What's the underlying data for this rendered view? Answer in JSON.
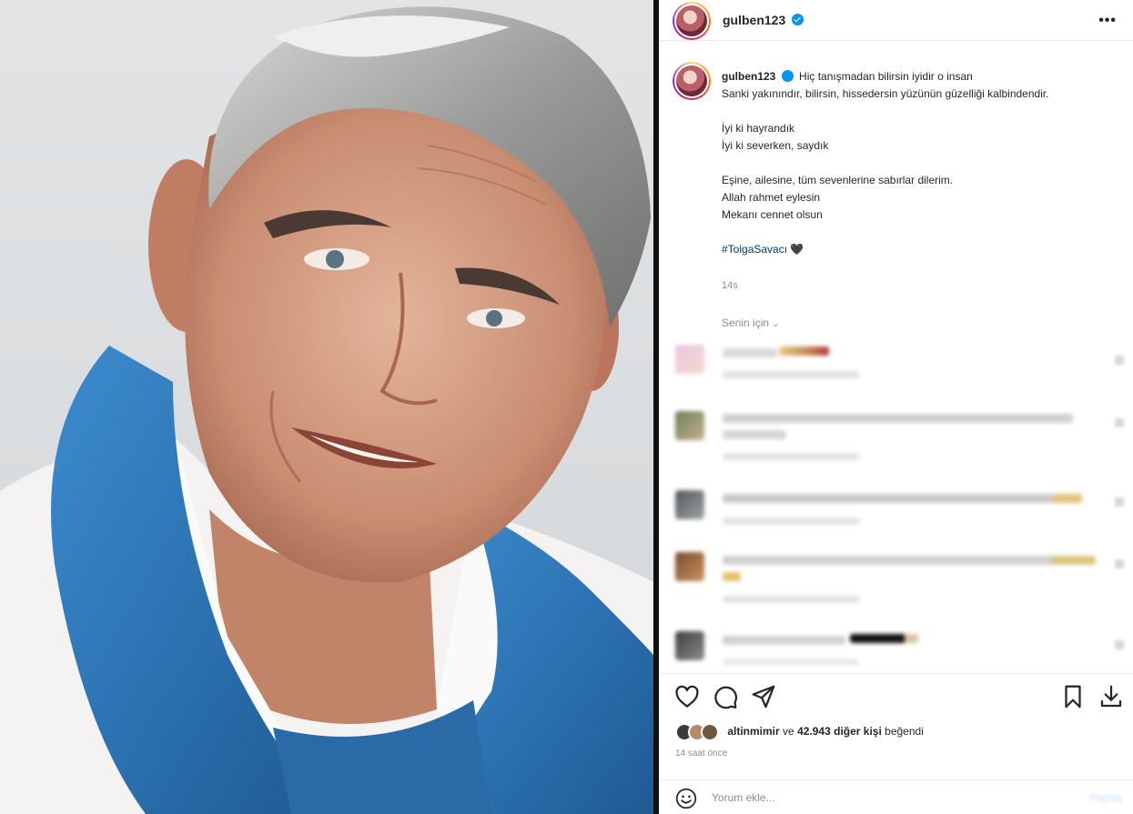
{
  "post": {
    "username": "gulben123",
    "verified": true,
    "more_icon": "more-horizontal-icon"
  },
  "caption": {
    "username": "gulben123",
    "lines": [
      "Hiç tanışmadan bilirsin iyidir o insan",
      "Sanki yakınındır, bilirsin, hissedersin yüzünün güzelliği kalbindendir.",
      "",
      "İyi ki hayrandık",
      "İyi ki severken, saydık",
      "",
      "Eşine, ailesine, tüm sevenlerine sabırlar dilerim.",
      "Allah rahmet eylesin",
      "Mekanı cennet olsun",
      ""
    ],
    "hashtag": "#TolgaSavacı 🖤",
    "time": "14s"
  },
  "comments_filter": {
    "label": "Senin için",
    "icon": "chevron-down-icon"
  },
  "comments_blurred_count": 5,
  "actions": {
    "like_icon": "heart-icon",
    "comment_icon": "comment-icon",
    "share_icon": "send-icon",
    "save_icon": "bookmark-icon",
    "download_icon": "download-icon"
  },
  "likes": {
    "user": "altinmimir",
    "connector": "ve",
    "others": "42.943 diğer kişi",
    "suffix": "beğendi"
  },
  "posted_ago": "14 saat önce",
  "comment_box": {
    "emoji_icon": "smiley-icon",
    "placeholder": "Yorum ekle...",
    "share_label": "Paylaş"
  },
  "colors": {
    "link": "#00376b",
    "verified": "#0095f6",
    "muted": "#8e8e8e",
    "scarf_blue": "#2f79b8"
  }
}
